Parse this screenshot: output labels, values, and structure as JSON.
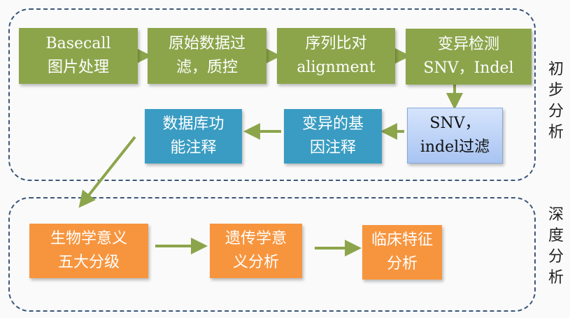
{
  "groups": {
    "preliminary": "初步分析",
    "deep": "深度分析"
  },
  "steps": {
    "basecall": [
      "Basecall",
      "图片处理"
    ],
    "filter_qc": [
      "原始数据过",
      "滤，质控"
    ],
    "alignment": [
      "序列比对",
      "alignment"
    ],
    "variant_call": [
      "变异检测",
      "SNV，Indel"
    ],
    "snv_filter": [
      "SNV，",
      "indel过滤"
    ],
    "gene_anno": [
      "变异的基",
      "因注释"
    ],
    "db_anno": [
      "数据库功",
      "能注释"
    ],
    "bio_meaning": [
      "生物学意义",
      "五大分级"
    ],
    "genetic_meaning": [
      "遗传学意",
      "义分析"
    ],
    "clinical": [
      "临床特征",
      "分析"
    ]
  },
  "colors": {
    "green": "#8ca54b",
    "blue": "#3a9cc2",
    "orange": "#f7953e",
    "arrow": "#8ca54b",
    "dash": "#3b587a"
  }
}
